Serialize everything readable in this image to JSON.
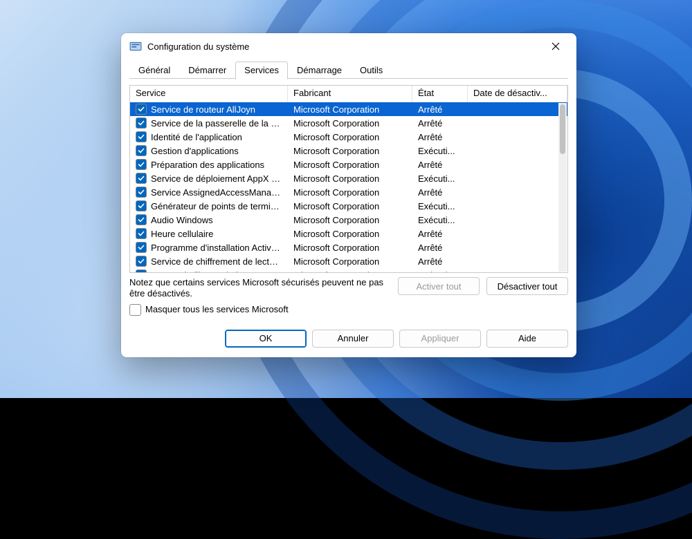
{
  "window": {
    "title": "Configuration du système"
  },
  "tabs": {
    "general": "Général",
    "boot": "Démarrer",
    "services": "Services",
    "startup": "Démarrage",
    "tools": "Outils",
    "active": "services"
  },
  "columns": {
    "service": "Service",
    "vendor": "Fabricant",
    "state": "État",
    "date": "Date de désactiv..."
  },
  "services": [
    {
      "name": "Service de routeur AllJoyn",
      "vendor": "Microsoft Corporation",
      "state": "Arrêté",
      "checked": true,
      "selected": true
    },
    {
      "name": "Service de la passerelle de la co...",
      "vendor": "Microsoft Corporation",
      "state": "Arrêté",
      "checked": true
    },
    {
      "name": "Identité de l'application",
      "vendor": "Microsoft Corporation",
      "state": "Arrêté",
      "checked": true
    },
    {
      "name": "Gestion d'applications",
      "vendor": "Microsoft Corporation",
      "state": "Exécuti...",
      "checked": true
    },
    {
      "name": "Préparation des applications",
      "vendor": "Microsoft Corporation",
      "state": "Arrêté",
      "checked": true
    },
    {
      "name": "Service de déploiement AppX (A...",
      "vendor": "Microsoft Corporation",
      "state": "Exécuti...",
      "checked": true
    },
    {
      "name": "Service AssignedAccessManager",
      "vendor": "Microsoft Corporation",
      "state": "Arrêté",
      "checked": true
    },
    {
      "name": "Générateur de points de termin...",
      "vendor": "Microsoft Corporation",
      "state": "Exécuti...",
      "checked": true
    },
    {
      "name": "Audio Windows",
      "vendor": "Microsoft Corporation",
      "state": "Exécuti...",
      "checked": true
    },
    {
      "name": "Heure cellulaire",
      "vendor": "Microsoft Corporation",
      "state": "Arrêté",
      "checked": true
    },
    {
      "name": "Programme d'installation Active...",
      "vendor": "Microsoft Corporation",
      "state": "Arrêté",
      "checked": true
    },
    {
      "name": "Service de chiffrement de lecteu...",
      "vendor": "Microsoft Corporation",
      "state": "Arrêté",
      "checked": true
    },
    {
      "name": "Moteur de filtrage de base",
      "vendor": "Microsoft Corporation",
      "state": "Exécuti...",
      "checked": true
    }
  ],
  "note": {
    "text": "Notez que certains services Microsoft sécurisés peuvent ne pas être désactivés.",
    "hide_label": "Masquer tous les services Microsoft"
  },
  "buttons": {
    "enable_all": "Activer tout",
    "disable_all": "Désactiver tout",
    "ok": "OK",
    "cancel": "Annuler",
    "apply": "Appliquer",
    "help": "Aide"
  }
}
